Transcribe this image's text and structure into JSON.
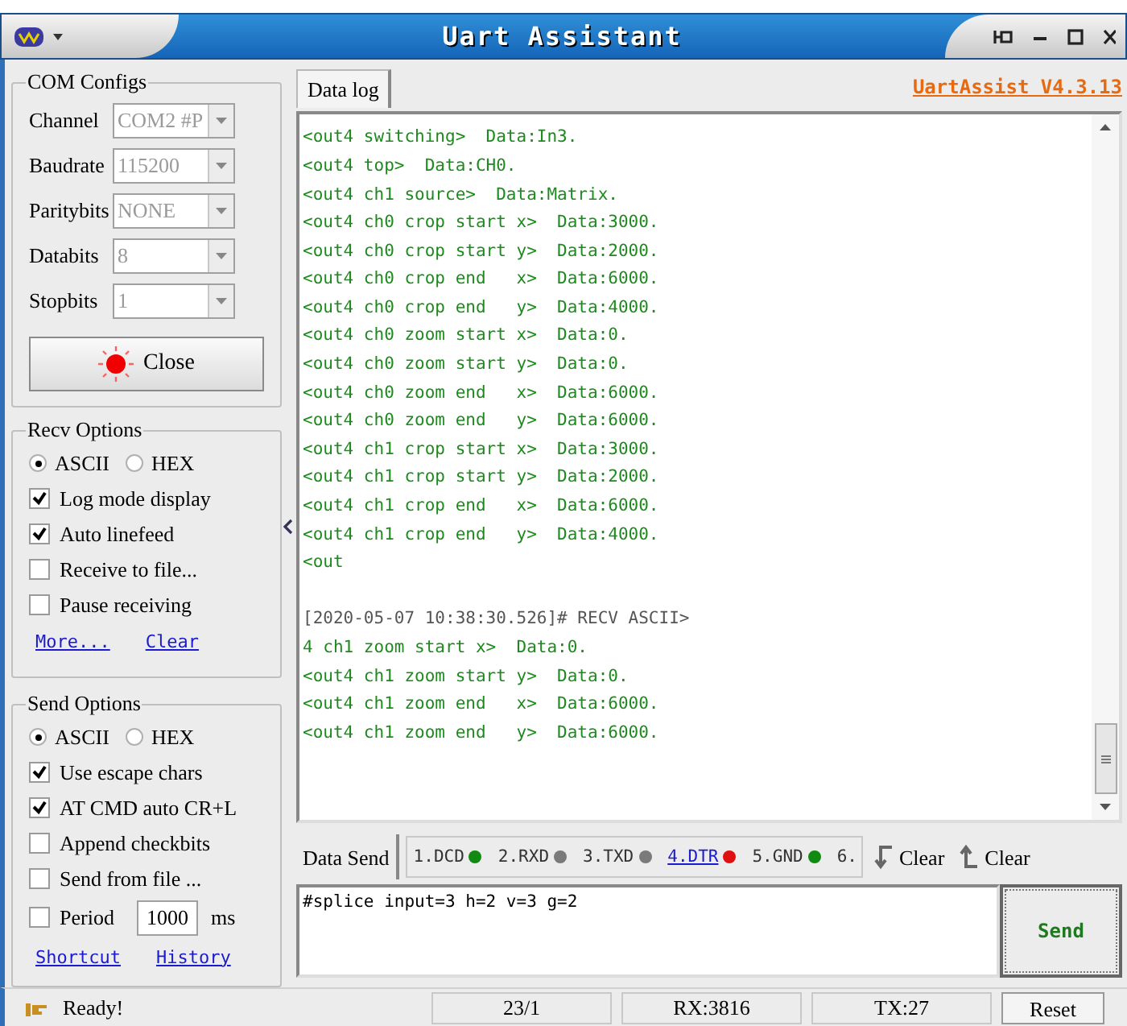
{
  "window": {
    "title": "Uart Assistant"
  },
  "com_configs": {
    "title": "COM Configs",
    "fields": [
      {
        "label": "Channel",
        "value": "COM2 #P"
      },
      {
        "label": "Baudrate",
        "value": "115200"
      },
      {
        "label": "Paritybits",
        "value": "NONE"
      },
      {
        "label": "Databits",
        "value": "8"
      },
      {
        "label": "Stopbits",
        "value": "1"
      }
    ],
    "close_button": {
      "label": "Close",
      "port_open": true
    }
  },
  "recv_options": {
    "title": "Recv Options",
    "encoding": [
      {
        "label": "ASCII",
        "selected": true
      },
      {
        "label": "HEX",
        "selected": false
      }
    ],
    "checkboxes": [
      {
        "label": "Log mode display",
        "checked": true
      },
      {
        "label": "Auto linefeed",
        "checked": true
      },
      {
        "label": "Receive to file...",
        "checked": false
      },
      {
        "label": "Pause receiving",
        "checked": false
      }
    ],
    "links": [
      "More...",
      "Clear"
    ]
  },
  "send_options": {
    "title": "Send Options",
    "encoding": [
      {
        "label": "ASCII",
        "selected": true
      },
      {
        "label": "HEX",
        "selected": false
      }
    ],
    "checkboxes": [
      {
        "label": "Use escape chars",
        "checked": true
      },
      {
        "label": "AT CMD auto CR+L",
        "checked": true
      },
      {
        "label": "Append checkbits",
        "checked": false
      },
      {
        "label": "Send from file ...",
        "checked": false
      }
    ],
    "period": {
      "label": "Period",
      "checked": false,
      "value": "1000",
      "unit": "ms"
    },
    "links": [
      "Shortcut",
      "History"
    ]
  },
  "data_log": {
    "tab": "Data log",
    "version_link": "UartAssist V4.3.13",
    "lines": [
      {
        "kind": "data",
        "text": "<out4 switching>  Data:In3."
      },
      {
        "kind": "data",
        "text": "<out4 top>  Data:CH0."
      },
      {
        "kind": "data",
        "text": "<out4 ch1 source>  Data:Matrix."
      },
      {
        "kind": "data",
        "text": "<out4 ch0 crop start x>  Data:3000."
      },
      {
        "kind": "data",
        "text": "<out4 ch0 crop start y>  Data:2000."
      },
      {
        "kind": "data",
        "text": "<out4 ch0 crop end   x>  Data:6000."
      },
      {
        "kind": "data",
        "text": "<out4 ch0 crop end   y>  Data:4000."
      },
      {
        "kind": "data",
        "text": "<out4 ch0 zoom start x>  Data:0."
      },
      {
        "kind": "data",
        "text": "<out4 ch0 zoom start y>  Data:0."
      },
      {
        "kind": "data",
        "text": "<out4 ch0 zoom end   x>  Data:6000."
      },
      {
        "kind": "data",
        "text": "<out4 ch0 zoom end   y>  Data:6000."
      },
      {
        "kind": "data",
        "text": "<out4 ch1 crop start x>  Data:3000."
      },
      {
        "kind": "data",
        "text": "<out4 ch1 crop start y>  Data:2000."
      },
      {
        "kind": "data",
        "text": "<out4 ch1 crop end   x>  Data:6000."
      },
      {
        "kind": "data",
        "text": "<out4 ch1 crop end   y>  Data:4000."
      },
      {
        "kind": "data",
        "text": "<out"
      },
      {
        "kind": "gap"
      },
      {
        "kind": "header",
        "text": "[2020-05-07 10:38:30.526]# RECV ASCII>"
      },
      {
        "kind": "data",
        "text": "4 ch1 zoom start x>  Data:0."
      },
      {
        "kind": "data",
        "text": "<out4 ch1 zoom start y>  Data:0."
      },
      {
        "kind": "data",
        "text": "<out4 ch1 zoom end   x>  Data:6000."
      },
      {
        "kind": "data",
        "text": "<out4 ch1 zoom end   y>  Data:6000."
      }
    ]
  },
  "data_send": {
    "tab": "Data Send",
    "signals": [
      {
        "label": "1.DCD",
        "color": "#108a10",
        "link": false
      },
      {
        "label": "2.RXD",
        "color": "#7a7a7a",
        "link": false
      },
      {
        "label": "3.TXD",
        "color": "#7a7a7a",
        "link": false
      },
      {
        "label": "4.DTR",
        "color": "#e01010",
        "link": true
      },
      {
        "label": "5.GND",
        "color": "#108a10",
        "link": false
      },
      {
        "label": "6.",
        "link": false
      }
    ],
    "clear_buttons": [
      "Clear",
      "Clear"
    ],
    "input": {
      "value": "#splice input=3 h=2 v=3 g=2"
    },
    "send_button": "Send"
  },
  "status_bar": {
    "message": "Ready!",
    "cells": [
      "23/1",
      "RX:3816",
      "TX:27"
    ],
    "reset_button": "Reset"
  }
}
